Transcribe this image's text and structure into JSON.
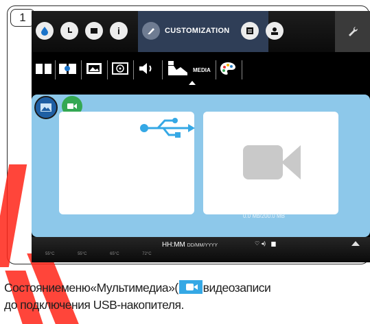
{
  "step": {
    "number": "1"
  },
  "topbar": {
    "active_tab_label": "CUSTOMIZATION",
    "info_glyph": "i",
    "items": [
      "drop-icon",
      "clock-icon",
      "flag-icon",
      "info-icon",
      "customization-icon",
      "calendar-icon",
      "user-icon",
      "wrench-icon"
    ]
  },
  "subbar": {
    "media_label": "MEDIA",
    "items": [
      "book-icon",
      "book-drop-icon",
      "picture-icon",
      "disc-icon",
      "speaker-icon",
      "media-icon",
      "palette-icon"
    ]
  },
  "panel": {
    "modes": [
      "photo-mode-icon",
      "video-mode-icon"
    ],
    "storage_text": "0.0 Mb/200.0 MB"
  },
  "statusbar": {
    "time": "HH:MM",
    "date": "DD/MM/YYYY",
    "temperatures": [
      "55°C",
      "55°C",
      "65°C",
      "72°C"
    ]
  },
  "caption": {
    "line1_before": "Состояниеменю«Мультимедиа»(",
    "line1_after": "видеозаписи",
    "line2": "до подключения USB-накопителя."
  },
  "colors": {
    "panel_blue": "#8dc8ea",
    "active_tab": "#2f3e57",
    "accent_red": "#ff2418",
    "video_green": "#34a853",
    "photo_blue": "#2b7fc4"
  }
}
